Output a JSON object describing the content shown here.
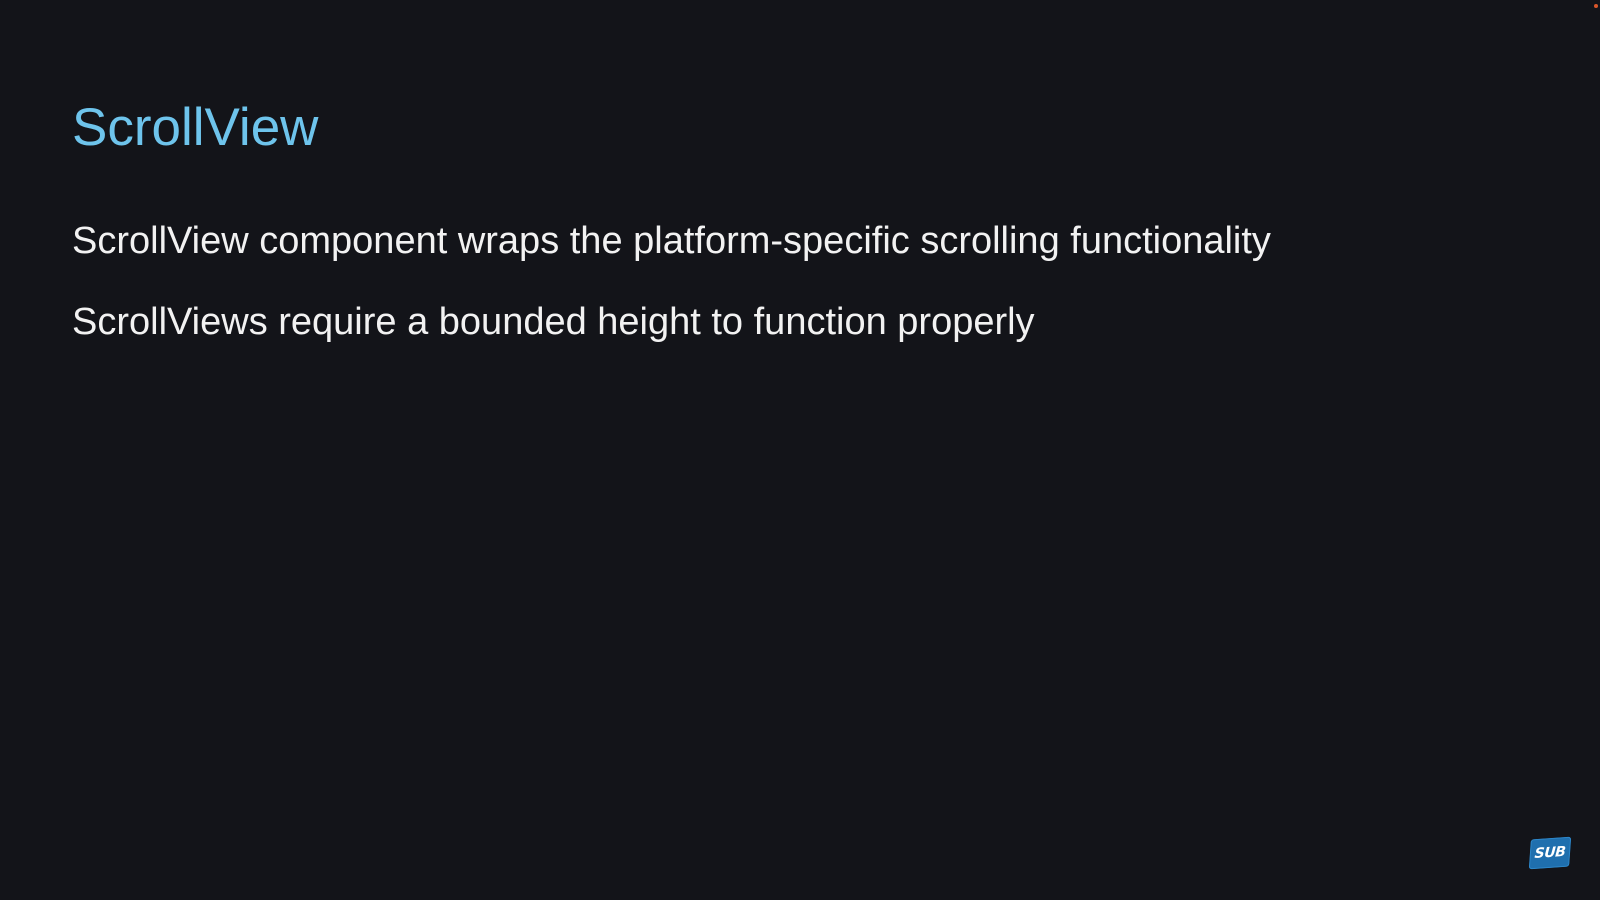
{
  "slide": {
    "title": "ScrollView",
    "bullets": [
      "ScrollView component wraps the platform-specific scrolling functionality",
      "ScrollViews require a bounded height to function properly"
    ]
  },
  "badge": {
    "label": "SUB"
  },
  "colors": {
    "background": "#131419",
    "title": "#6ec4ec",
    "body_text": "#f2f2f2",
    "badge": "#1f6fae",
    "corner_dot": "#d9562a"
  }
}
